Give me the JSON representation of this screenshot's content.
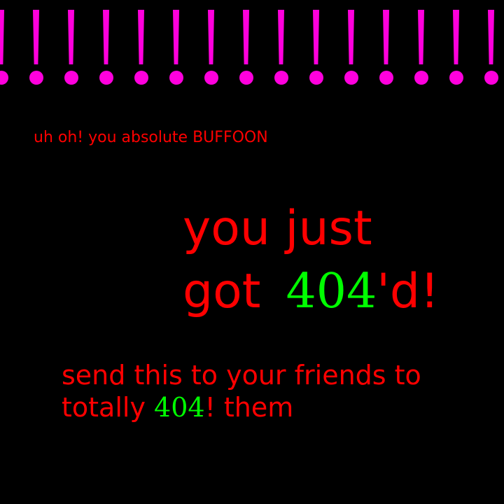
{
  "banner": {
    "glyph": "!",
    "count": 15,
    "color": "#ff00dd"
  },
  "subtitle": "uh oh! you absolute BUFFOON",
  "headline": {
    "line1": "you just",
    "line2_prefix": "got",
    "line2_number": "404",
    "line2_suffix": "'d!"
  },
  "footer": {
    "line1": "send this to your friends to",
    "line2_prefix": "totally",
    "line2_number": "404",
    "line2_suffix": "! them"
  },
  "colors": {
    "background": "#000000",
    "text": "#ff0000",
    "accent": "#00ff00",
    "banner": "#ff00dd"
  }
}
